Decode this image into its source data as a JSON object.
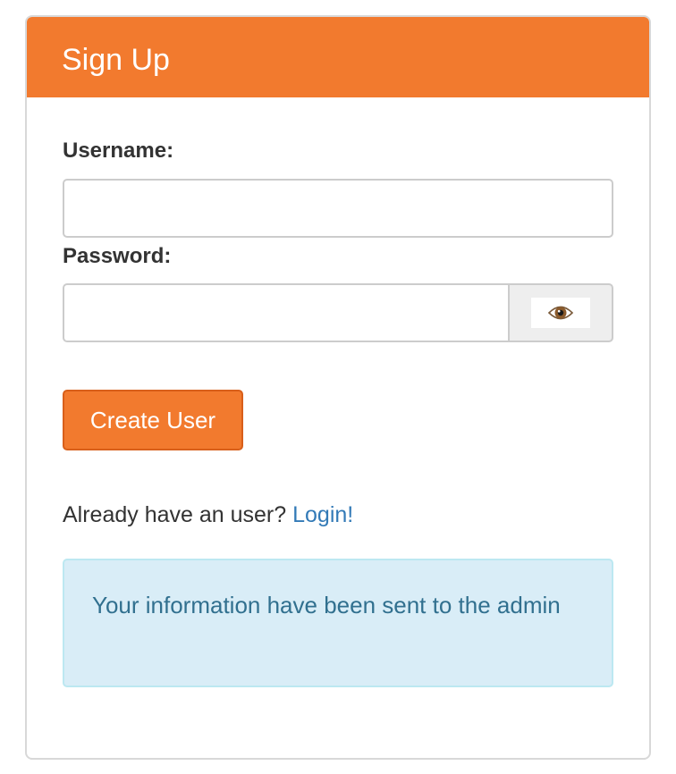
{
  "panel": {
    "title": "Sign Up",
    "heading_color": "#f27a2e"
  },
  "form": {
    "username_label": "Username:",
    "username_value": "",
    "password_label": "Password:",
    "password_value": "",
    "toggle_icon": "eye-icon",
    "submit_label": "Create User"
  },
  "login_prompt": {
    "text": "Already have an user?",
    "link_label": "Login!"
  },
  "alert": {
    "message": "Your information have been sent to the admin"
  },
  "colors": {
    "accent": "#f27a2e",
    "link": "#337ab7",
    "info_bg": "#d9edf7",
    "info_text": "#31708f"
  }
}
